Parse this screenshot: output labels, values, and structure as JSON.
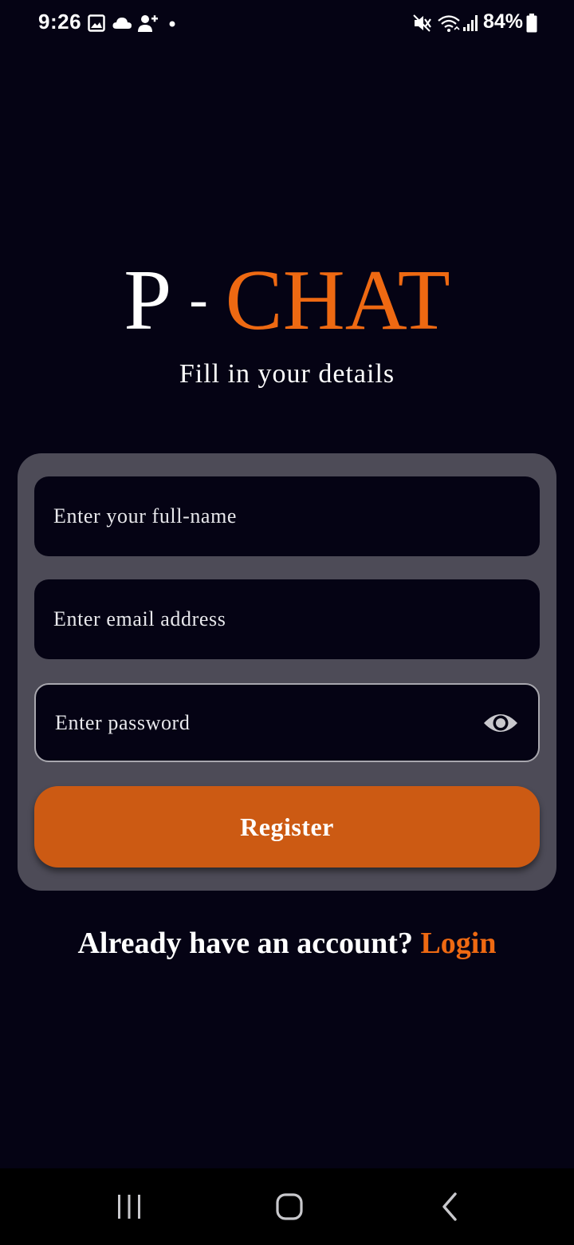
{
  "status_bar": {
    "time": "9:26",
    "battery": "84%",
    "left_icons": [
      "gallery-icon",
      "cloud-icon",
      "add-person-icon",
      "notification-dot-icon"
    ],
    "right_icons": [
      "mute-icon",
      "wifi-icon",
      "signal-icon",
      "battery-icon"
    ]
  },
  "brand": {
    "p": "P",
    "dash": "-",
    "chat": "CHAT"
  },
  "subtitle": "Fill in your details",
  "form": {
    "fullname_placeholder": "Enter your full-name",
    "email_placeholder": "Enter email address",
    "password_placeholder": "Enter password",
    "register_label": "Register"
  },
  "login_prompt": {
    "text": "Already have an account?",
    "link": "Login"
  },
  "nav": {
    "icons": [
      "recent-apps-icon",
      "home-icon",
      "back-icon"
    ]
  },
  "colors": {
    "background": "#050314",
    "accent": "#ee6912",
    "button": "#cc5a13",
    "card": "#4d4b57"
  }
}
